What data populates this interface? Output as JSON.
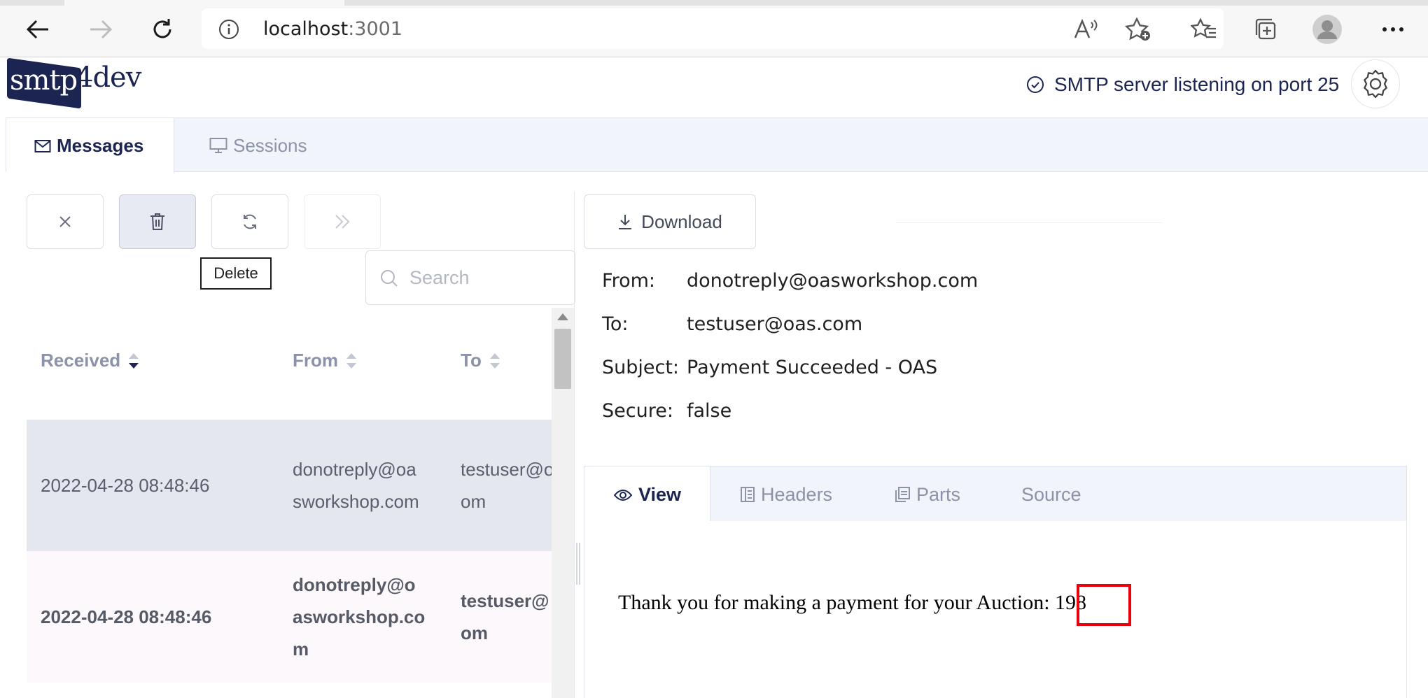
{
  "browser": {
    "url_host": "localhost",
    "url_port": ":3001"
  },
  "app": {
    "logo_highlight": "smtp",
    "logo_rest": "4dev",
    "server_status": "SMTP server listening on port 25"
  },
  "main_tabs": {
    "messages": "Messages",
    "sessions": "Sessions"
  },
  "toolbar": {
    "delete_tooltip": "Delete"
  },
  "search": {
    "placeholder": "Search",
    "value": ""
  },
  "table": {
    "columns": [
      "Received",
      "From",
      "To"
    ],
    "sort_column": "Received",
    "rows": [
      {
        "received": "2022-04-28 08:48:46",
        "from_lines": [
          "donotreply@oa",
          "sworkshop.com"
        ],
        "to_lines": [
          "testuser@o",
          "om"
        ],
        "state": "selected"
      },
      {
        "received": "2022-04-28 08:48:46",
        "from_lines": [
          "donotreply@o",
          "asworkshop.co",
          "m"
        ],
        "to_lines": [
          "testuser@",
          "om"
        ],
        "state": "unread"
      }
    ]
  },
  "message": {
    "download_label": "Download",
    "from_label": "From:",
    "from": "donotreply@oasworkshop.com",
    "to_label": "To:",
    "to": "testuser@oas.com",
    "subject_label": "Subject:",
    "subject": "Payment Succeeded - OAS",
    "secure_label": "Secure:",
    "secure": "false",
    "tabs": [
      "View",
      "Headers",
      "Parts",
      "Source"
    ],
    "body_prefix": "Thank you for making a payment for your Auction:",
    "body_value": "198",
    "highlight_color": "#e8000b"
  },
  "colors": {
    "brand": "#1c2452",
    "muted": "#8c93a8",
    "tab_bg": "#f1f4fb",
    "selected_row": "#e5e7ee"
  }
}
